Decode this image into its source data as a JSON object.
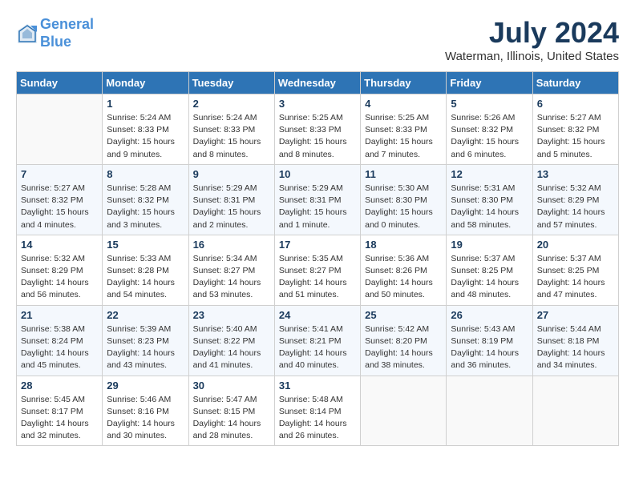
{
  "header": {
    "logo_line1": "General",
    "logo_line2": "Blue",
    "month_title": "July 2024",
    "location": "Waterman, Illinois, United States"
  },
  "weekdays": [
    "Sunday",
    "Monday",
    "Tuesday",
    "Wednesday",
    "Thursday",
    "Friday",
    "Saturday"
  ],
  "weeks": [
    [
      {
        "day": "",
        "info": ""
      },
      {
        "day": "1",
        "info": "Sunrise: 5:24 AM\nSunset: 8:33 PM\nDaylight: 15 hours\nand 9 minutes."
      },
      {
        "day": "2",
        "info": "Sunrise: 5:24 AM\nSunset: 8:33 PM\nDaylight: 15 hours\nand 8 minutes."
      },
      {
        "day": "3",
        "info": "Sunrise: 5:25 AM\nSunset: 8:33 PM\nDaylight: 15 hours\nand 8 minutes."
      },
      {
        "day": "4",
        "info": "Sunrise: 5:25 AM\nSunset: 8:33 PM\nDaylight: 15 hours\nand 7 minutes."
      },
      {
        "day": "5",
        "info": "Sunrise: 5:26 AM\nSunset: 8:32 PM\nDaylight: 15 hours\nand 6 minutes."
      },
      {
        "day": "6",
        "info": "Sunrise: 5:27 AM\nSunset: 8:32 PM\nDaylight: 15 hours\nand 5 minutes."
      }
    ],
    [
      {
        "day": "7",
        "info": "Sunrise: 5:27 AM\nSunset: 8:32 PM\nDaylight: 15 hours\nand 4 minutes."
      },
      {
        "day": "8",
        "info": "Sunrise: 5:28 AM\nSunset: 8:32 PM\nDaylight: 15 hours\nand 3 minutes."
      },
      {
        "day": "9",
        "info": "Sunrise: 5:29 AM\nSunset: 8:31 PM\nDaylight: 15 hours\nand 2 minutes."
      },
      {
        "day": "10",
        "info": "Sunrise: 5:29 AM\nSunset: 8:31 PM\nDaylight: 15 hours\nand 1 minute."
      },
      {
        "day": "11",
        "info": "Sunrise: 5:30 AM\nSunset: 8:30 PM\nDaylight: 15 hours\nand 0 minutes."
      },
      {
        "day": "12",
        "info": "Sunrise: 5:31 AM\nSunset: 8:30 PM\nDaylight: 14 hours\nand 58 minutes."
      },
      {
        "day": "13",
        "info": "Sunrise: 5:32 AM\nSunset: 8:29 PM\nDaylight: 14 hours\nand 57 minutes."
      }
    ],
    [
      {
        "day": "14",
        "info": "Sunrise: 5:32 AM\nSunset: 8:29 PM\nDaylight: 14 hours\nand 56 minutes."
      },
      {
        "day": "15",
        "info": "Sunrise: 5:33 AM\nSunset: 8:28 PM\nDaylight: 14 hours\nand 54 minutes."
      },
      {
        "day": "16",
        "info": "Sunrise: 5:34 AM\nSunset: 8:27 PM\nDaylight: 14 hours\nand 53 minutes."
      },
      {
        "day": "17",
        "info": "Sunrise: 5:35 AM\nSunset: 8:27 PM\nDaylight: 14 hours\nand 51 minutes."
      },
      {
        "day": "18",
        "info": "Sunrise: 5:36 AM\nSunset: 8:26 PM\nDaylight: 14 hours\nand 50 minutes."
      },
      {
        "day": "19",
        "info": "Sunrise: 5:37 AM\nSunset: 8:25 PM\nDaylight: 14 hours\nand 48 minutes."
      },
      {
        "day": "20",
        "info": "Sunrise: 5:37 AM\nSunset: 8:25 PM\nDaylight: 14 hours\nand 47 minutes."
      }
    ],
    [
      {
        "day": "21",
        "info": "Sunrise: 5:38 AM\nSunset: 8:24 PM\nDaylight: 14 hours\nand 45 minutes."
      },
      {
        "day": "22",
        "info": "Sunrise: 5:39 AM\nSunset: 8:23 PM\nDaylight: 14 hours\nand 43 minutes."
      },
      {
        "day": "23",
        "info": "Sunrise: 5:40 AM\nSunset: 8:22 PM\nDaylight: 14 hours\nand 41 minutes."
      },
      {
        "day": "24",
        "info": "Sunrise: 5:41 AM\nSunset: 8:21 PM\nDaylight: 14 hours\nand 40 minutes."
      },
      {
        "day": "25",
        "info": "Sunrise: 5:42 AM\nSunset: 8:20 PM\nDaylight: 14 hours\nand 38 minutes."
      },
      {
        "day": "26",
        "info": "Sunrise: 5:43 AM\nSunset: 8:19 PM\nDaylight: 14 hours\nand 36 minutes."
      },
      {
        "day": "27",
        "info": "Sunrise: 5:44 AM\nSunset: 8:18 PM\nDaylight: 14 hours\nand 34 minutes."
      }
    ],
    [
      {
        "day": "28",
        "info": "Sunrise: 5:45 AM\nSunset: 8:17 PM\nDaylight: 14 hours\nand 32 minutes."
      },
      {
        "day": "29",
        "info": "Sunrise: 5:46 AM\nSunset: 8:16 PM\nDaylight: 14 hours\nand 30 minutes."
      },
      {
        "day": "30",
        "info": "Sunrise: 5:47 AM\nSunset: 8:15 PM\nDaylight: 14 hours\nand 28 minutes."
      },
      {
        "day": "31",
        "info": "Sunrise: 5:48 AM\nSunset: 8:14 PM\nDaylight: 14 hours\nand 26 minutes."
      },
      {
        "day": "",
        "info": ""
      },
      {
        "day": "",
        "info": ""
      },
      {
        "day": "",
        "info": ""
      }
    ]
  ]
}
